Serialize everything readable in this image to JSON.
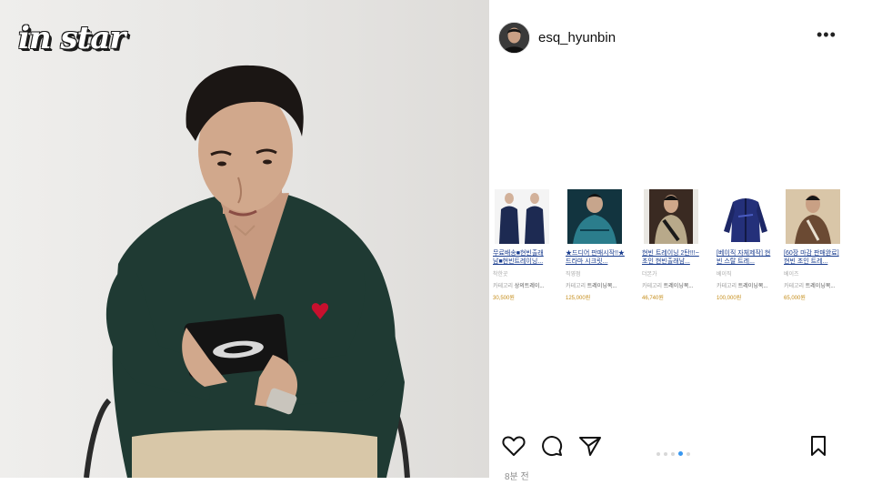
{
  "video": {
    "logo_text": "in star"
  },
  "post": {
    "username": "esq_hyunbin",
    "more_label": "•••",
    "timestamp": "8분 전",
    "carousel": {
      "count": 5,
      "active": 4
    },
    "icons": {
      "more": "more-options-icon",
      "like": "heart-icon",
      "comment": "comment-icon",
      "share": "send-icon",
      "save": "bookmark-icon"
    },
    "products": [
      {
        "title": "무료배송■현빈출래",
        "title2": "남■현빈트레이닝...",
        "seller": "착한곳",
        "cat_label": "카테고리",
        "cat_value": "상의트레이...",
        "price": "30,500원"
      },
      {
        "title": "★드디어 판매시작!!★",
        "title2": "드라마 시크릿...",
        "seller": "직영점",
        "cat_label": "카테고리",
        "cat_value": "트레이닝복...",
        "price": "125,000원"
      },
      {
        "title": "현빈 트레이닝 2탄!!!~",
        "title2": "초인 현빈출래남...",
        "seller": "더본가",
        "cat_label": "카테고리",
        "cat_value": "트레이닝복...",
        "price": "46,740원"
      },
      {
        "title": "[베이직 자체제작] 현",
        "title2": "빈 스탈 트레...",
        "seller": "베이직",
        "cat_label": "카테고리",
        "cat_value": "트레이닝복...",
        "price": "100,000원"
      },
      {
        "title": "[60장 마감 판매완료]",
        "title2": "현빈 초인 트레...",
        "seller": "베이즈",
        "cat_label": "카테고리",
        "cat_value": "트레이닝복...",
        "price": "65,000원"
      }
    ]
  },
  "colors": {
    "link_blue": "#1a3d8f",
    "price_gold": "#c58d1a",
    "carousel_active": "#3897f0",
    "sweater_green": "#1f3a33"
  }
}
